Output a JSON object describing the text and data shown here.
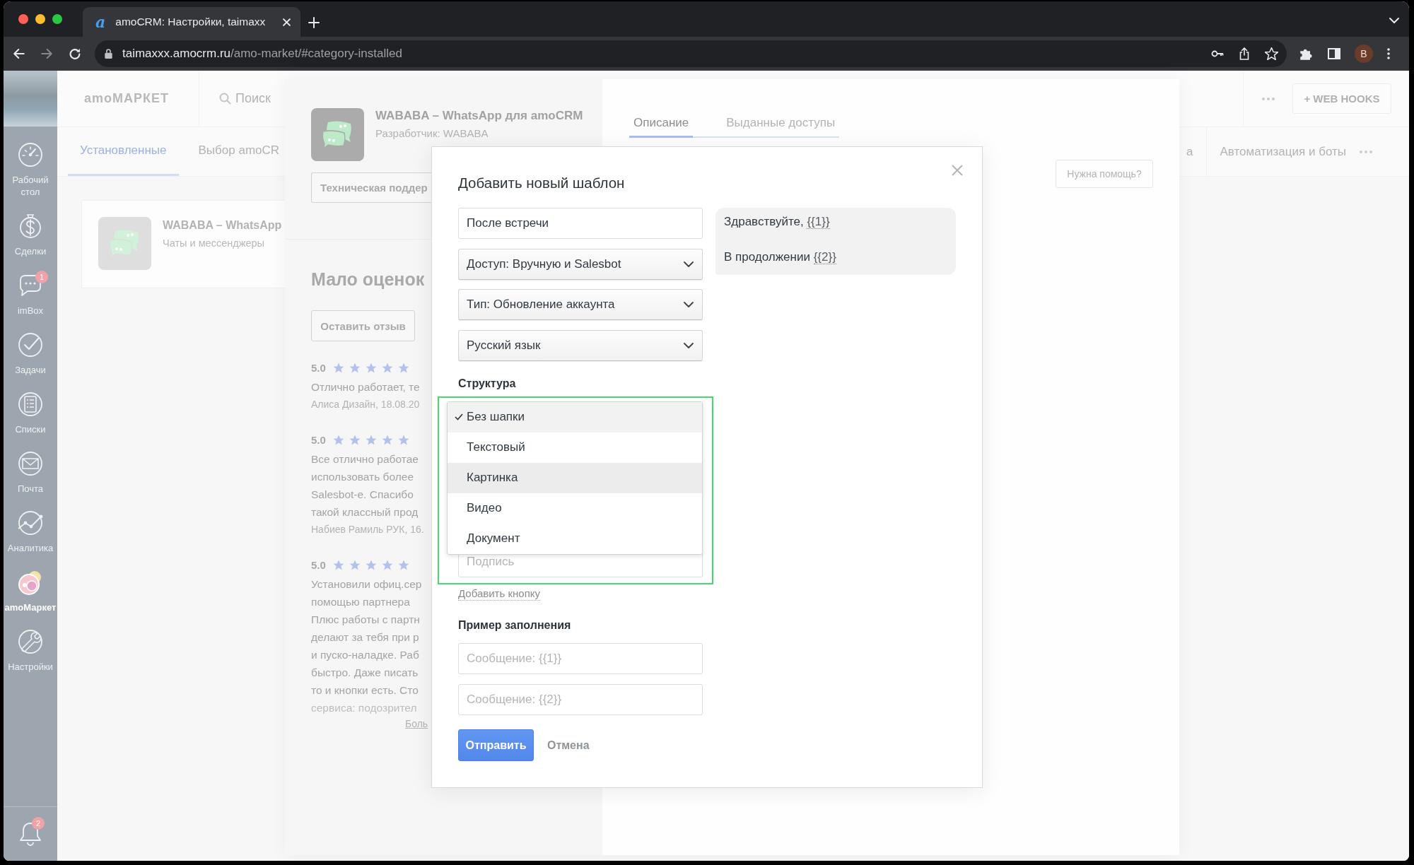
{
  "browser": {
    "tab": {
      "favicon": "a",
      "title": "amoCRM: Настройки, taimaxx",
      "selected": true
    },
    "forward_disabled": true,
    "address": {
      "host": "taimaxxx.amocrm.ru",
      "path": "/amo-market/#category-installed"
    },
    "profile": "B"
  },
  "sidebar": {
    "items": [
      {
        "label": "Рабочий стол",
        "selected": false
      },
      {
        "label": "Сделки",
        "selected": false
      },
      {
        "label": "imBox",
        "selected": false,
        "badge": "1"
      },
      {
        "label": "Задачи",
        "selected": false
      },
      {
        "label": "Списки",
        "selected": false
      },
      {
        "label": "Почта",
        "selected": false
      },
      {
        "label": "Аналитика",
        "selected": false
      },
      {
        "label": "amoМаркет",
        "selected": true
      },
      {
        "label": "Настройки",
        "selected": false
      }
    ],
    "notifications": {
      "badge": "2"
    }
  },
  "market": {
    "logo": "amoМАРКЕТ",
    "search": {
      "placeholder": "Поиск"
    },
    "webhooks_button": "+ WEB HOOKS",
    "tabs": [
      {
        "label": "Установленные",
        "selected": true
      },
      {
        "label": "Выбор amoCR",
        "selected": false
      }
    ],
    "right_tabs": [
      {
        "label": "а",
        "selected": false
      },
      {
        "label": "Автоматизация и боты",
        "selected": false
      }
    ],
    "installed": [
      {
        "title": "WABABA – WhatsApp",
        "category": "Чаты и мессенджеры"
      }
    ]
  },
  "app_panel": {
    "title": "WABABA – WhatsApp для amoCRM",
    "developer": "Разработчик: WABABA",
    "support_button": "Техническая поддер",
    "rating_heading": "Мало оценок",
    "review_button": "Оставить отзыв",
    "reviews": [
      {
        "rating": "5.0",
        "stars": 5,
        "lines": [
          "Отлично работает, те"
        ],
        "author": "Алиса Дизайн, 18.08.20",
        "collapsed": false
      },
      {
        "rating": "5.0",
        "stars": 5,
        "lines": [
          "Все отлично работае",
          "использовать более",
          "Salesbot-е. Спасибо",
          "такой классный прод"
        ],
        "author": "Набиев Рамиль РУК, 16.",
        "collapsed": false
      },
      {
        "rating": "5.0",
        "stars": 5,
        "lines": [
          "Установили офиц.сер",
          "помощью партнера",
          "Плюс работы с партн",
          "делают за тебя при р",
          "и пуско-наладке. Раб",
          "быстро. Даже писать",
          "то и кнопки есть. Сто",
          "сервиса: подозрител"
        ],
        "collapsed": true
      }
    ],
    "more_link": "Боль",
    "tabs": [
      {
        "label": "Описание",
        "selected": true
      },
      {
        "label": "Выданные доступы",
        "selected": false
      }
    ],
    "help_button": "Нужна помощь?"
  },
  "modal": {
    "title": "Добавить новый шаблон",
    "name_field": {
      "value": "После встречи"
    },
    "selects": [
      {
        "value": "Доступ: Вручную и Salesbot"
      },
      {
        "value": "Тип: Обновление аккаунта"
      },
      {
        "value": "Русский язык"
      }
    ],
    "structure": {
      "label": "Структура",
      "options": [
        {
          "label": "Без шапки",
          "selected": true,
          "highlighted": false
        },
        {
          "label": "Текстовый",
          "selected": false,
          "highlighted": false
        },
        {
          "label": "Картинка",
          "selected": false,
          "highlighted": true
        },
        {
          "label": "Видео",
          "selected": false,
          "highlighted": false
        },
        {
          "label": "Документ",
          "selected": false,
          "highlighted": false
        }
      ]
    },
    "caption_field": {
      "placeholder": "Подпись"
    },
    "add_button_link": "Добавить кнопку",
    "example_label": "Пример заполнения",
    "example_fields": [
      {
        "placeholder": "Сообщение: {{1}}"
      },
      {
        "placeholder": "Сообщение: {{2}}"
      }
    ],
    "submit_button": "Отправить",
    "cancel_button": "Отмена",
    "preview": {
      "lines": [
        {
          "text": "Здравствуйте,",
          "variable": "{{1}}"
        },
        {
          "text": "В продолжении",
          "variable": "{{2}}"
        }
      ]
    }
  }
}
